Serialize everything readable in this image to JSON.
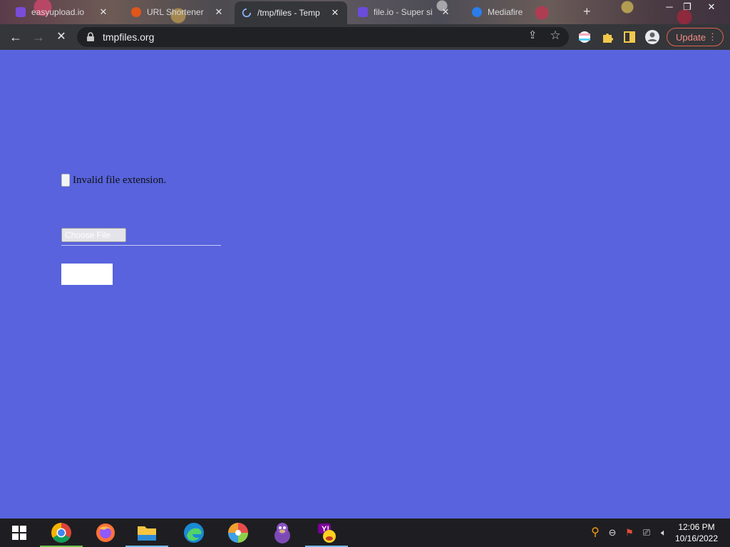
{
  "browser": {
    "tabs": [
      {
        "title": "easyupload.io",
        "favicon_color": "#7a4cd9"
      },
      {
        "title": "URL Shortener",
        "favicon_color": "#e0561b"
      },
      {
        "title": "/tmp/files - Temp",
        "favicon_color": "#8ab4f8"
      },
      {
        "title": "file.io - Super si",
        "favicon_color": "#6a4cdc"
      },
      {
        "title": "Mediafire",
        "favicon_color": "#2b7de9"
      }
    ],
    "new_tab_label": "+",
    "url": "tmpfiles.org",
    "update_label": "Update"
  },
  "page": {
    "error_message": "Invalid file extension.",
    "file_button_label": "Choose File",
    "background_color": "#5863dd"
  },
  "taskbar": {
    "apps": [
      "start",
      "chrome",
      "firefox",
      "file-explorer",
      "edge",
      "photos",
      "bonzi",
      "yahoo-messenger"
    ],
    "time": "12:06 PM",
    "date": "10/16/2022"
  }
}
